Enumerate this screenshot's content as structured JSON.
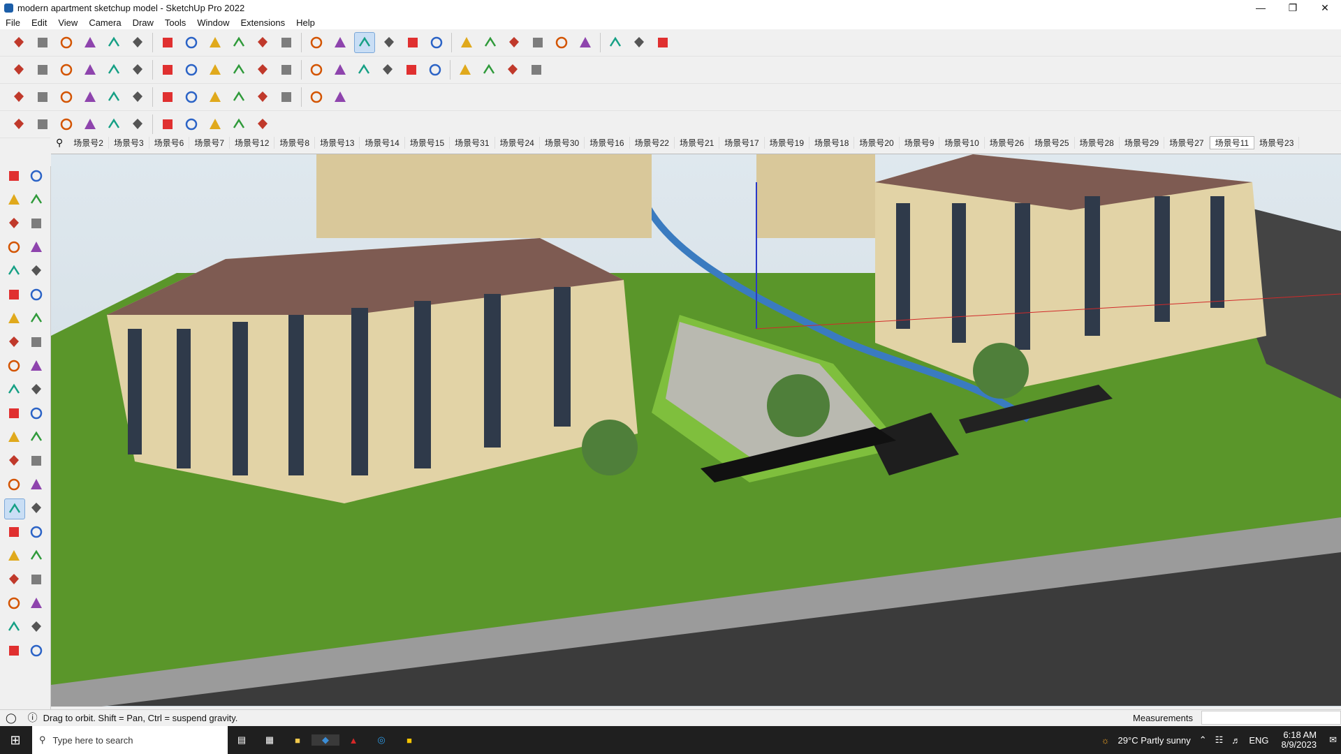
{
  "window": {
    "title": "modern apartment sketchup model - SketchUp Pro 2022",
    "controls": [
      "minimize-icon",
      "maximize-icon",
      "close-icon"
    ]
  },
  "menu": [
    "File",
    "Edit",
    "View",
    "Camera",
    "Draw",
    "Tools",
    "Window",
    "Extensions",
    "Help"
  ],
  "toolbars": {
    "row1": [
      "search-icon",
      "select-icon",
      "eraser-icon",
      "pencil-icon",
      "arc-icon",
      "rectangle-icon",
      "pushpull-icon",
      "followme-icon",
      "move-icon",
      "rotate-icon",
      "scale-icon",
      "tape-icon",
      "text-icon",
      "paint-icon",
      "orbit-icon",
      "pan-icon",
      "zoom-icon",
      "zoom-extents-icon",
      "warehouse-icon",
      "layers-icon",
      "sandbox-icon",
      "account-icon",
      "components-icon",
      "section-icon",
      "axes-icon",
      "undo-icon",
      "redo-icon"
    ],
    "row2": [
      "cube-icon",
      "box-icon",
      "box2-icon",
      "extrude-icon",
      "push-icon",
      "arrow-x-icon",
      "arrow-y-icon",
      "arrow-z-icon",
      "shell-icon",
      "plane-icon",
      "wall-icon",
      "door-icon",
      "house-icon",
      "roof-icon",
      "stair-icon",
      "text-3d-icon",
      "cut-icon",
      "lines-icon",
      "circle-icon",
      "hexagon-icon",
      "star-icon",
      "paint-bucket-icon"
    ],
    "row3": [
      "tile-icon",
      "blue-icon",
      "yellow-icon",
      "green-icon",
      "red-icon",
      "rotate2-icon",
      "frame-icon",
      "bars-icon",
      "cross-icon",
      "spiral-icon",
      "pyramid-icon",
      "magnet-icon",
      "grid-icon",
      "link-icon"
    ],
    "row4": [
      "bezier-icon",
      "curve-icon",
      "knot-icon",
      "scissors-icon",
      "sphere-icon",
      "helix-icon",
      "slope-icon",
      "hatch-icon",
      "plank-icon",
      "fence-icon",
      "tree-icon"
    ]
  },
  "scenes": [
    "场景号2",
    "场景号3",
    "场景号6",
    "场景号7",
    "场景号12",
    "场景号8",
    "场景号13",
    "场景号14",
    "场景号15",
    "场景号31",
    "场景号24",
    "场景号30",
    "场景号16",
    "场景号22",
    "场景号21",
    "场景号17",
    "场景号19",
    "场景号18",
    "场景号20",
    "场景号9",
    "场景号10",
    "场景号26",
    "场景号25",
    "场景号28",
    "场景号29",
    "场景号27",
    "场景号11",
    "场景号23"
  ],
  "active_scene": "场景号11",
  "left_tools": [
    "select-tool",
    "orbit-tool",
    "paint-tool",
    "eraser-tool",
    "component-tool",
    "tag-tool",
    "line-tool",
    "freehand-tool",
    "rectangle-tool",
    "rotated-rect-tool",
    "circle-tool",
    "polygon-tool",
    "arc-tool",
    "pie-tool",
    "arc2-tool",
    "arc3-tool",
    "move-tool",
    "pushpull-tool",
    "rotate-tool",
    "followme-tool",
    "scale-tool",
    "offset-tool",
    "tape-tool",
    "dimension-tool",
    "protractor-tool",
    "text-tool",
    "axes-tool",
    "3dtext-tool",
    "orbit2-tool",
    "pan-tool",
    "zoom-tool",
    "zoom-window-tool",
    "zoom-extents-tool",
    "position-camera-tool",
    "walk-tool",
    "lookaround-tool",
    "footprint-tool",
    "section-tool",
    "sandbox-tool",
    "smoove-tool",
    "layers-tool",
    "stamp-tool"
  ],
  "status": {
    "hint": "Drag to orbit. Shift = Pan, Ctrl = suspend gravity.",
    "measurements_label": "Measurements"
  },
  "taskbar": {
    "search_placeholder": "Type here to search",
    "weather": "29°C  Partly sunny",
    "lang": "ENG",
    "time": "6:18 AM",
    "date": "8/9/2023"
  },
  "colors": {
    "accent": "#1c5ea8",
    "active_tool_bg": "#c9def5",
    "grass": "#5e9c2c",
    "road": "#7a7a7a"
  }
}
